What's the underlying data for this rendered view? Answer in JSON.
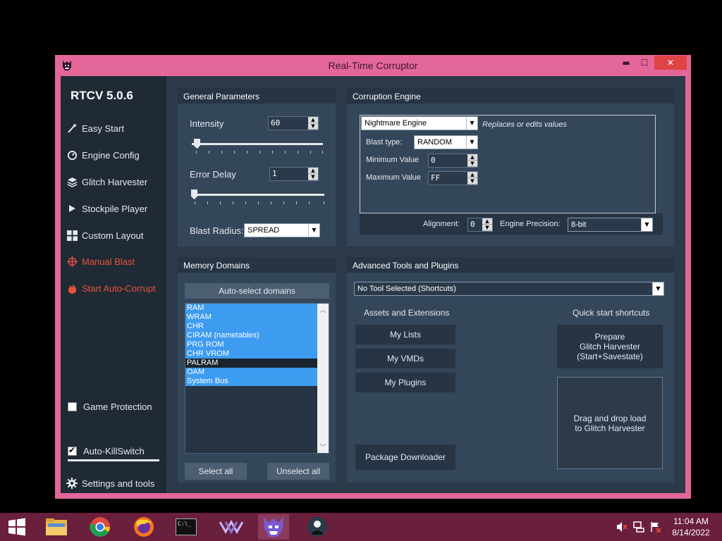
{
  "window": {
    "title": "Real-Time Corruptor",
    "min_glyph": "▬",
    "max_glyph": "☐",
    "close_glyph": "✕"
  },
  "sidebar": {
    "brand": "RTCV 5.0.6",
    "items": [
      {
        "label": "Easy Start",
        "icon": "wand-icon"
      },
      {
        "label": "Engine Config",
        "icon": "gauge-icon"
      },
      {
        "label": "Glitch Harvester",
        "icon": "layers-icon"
      },
      {
        "label": "Stockpile Player",
        "icon": "play-icon"
      },
      {
        "label": "Custom Layout",
        "icon": "grid-icon"
      },
      {
        "label": "Manual Blast",
        "icon": "crosshair-icon"
      },
      {
        "label": "Start Auto-Corrupt",
        "icon": "flame-icon"
      }
    ],
    "game_protection": "Game Protection",
    "auto_killswitch": "Auto-KillSwitch",
    "settings": "Settings and tools"
  },
  "general": {
    "title": "General Parameters",
    "intensity_label": "Intensity",
    "intensity_value": "60",
    "error_delay_label": "Error Delay",
    "error_delay_value": "1",
    "blast_radius_label": "Blast Radius:",
    "blast_radius_value": "SPREAD"
  },
  "engine": {
    "title": "Corruption Engine",
    "engine_value": "Nightmare Engine",
    "engine_hint": "Replaces or edits values",
    "blast_type_label": "Blast type:",
    "blast_type_value": "RANDOM",
    "min_label": "Minimum Value",
    "min_value": "0",
    "max_label": "Maximum Value",
    "max_value": "FF",
    "alignment_label": "Alignment:",
    "alignment_value": "0",
    "precision_label": "Engine Precision:",
    "precision_value": "8-bit"
  },
  "memory": {
    "title": "Memory Domains",
    "auto_select": "Auto-select domains",
    "domains": [
      {
        "name": "RAM",
        "selected": true
      },
      {
        "name": "WRAM",
        "selected": true
      },
      {
        "name": "CHR",
        "selected": true
      },
      {
        "name": "CIRAM (nametables)",
        "selected": true
      },
      {
        "name": "PRG ROM",
        "selected": true
      },
      {
        "name": "CHR VROM",
        "selected": true
      },
      {
        "name": "PALRAM",
        "selected": false
      },
      {
        "name": "OAM",
        "selected": true
      },
      {
        "name": "System Bus",
        "selected": true
      }
    ],
    "select_all": "Select all",
    "unselect_all": "Unselect all"
  },
  "advanced": {
    "title": "Advanced Tools and Plugins",
    "tool_value": "No Tool Selected (Shortcuts)",
    "assets_label": "Assets and Extensions",
    "quick_label": "Quick start shortcuts",
    "my_lists": "My Lists",
    "my_vmds": "My VMDs",
    "my_plugins": "My Plugins",
    "package_downloader": "Package Downloader",
    "prepare_line1": "Prepare",
    "prepare_line2": "Glitch Harvester",
    "prepare_line3": "(Start+Savestate)",
    "drop_line1": "Drag and drop load",
    "drop_line2": "to Glitch Harvester"
  },
  "taskbar": {
    "time": "11:04 AM",
    "date": "8/14/2022",
    "cmd_text": "C:\\_"
  }
}
